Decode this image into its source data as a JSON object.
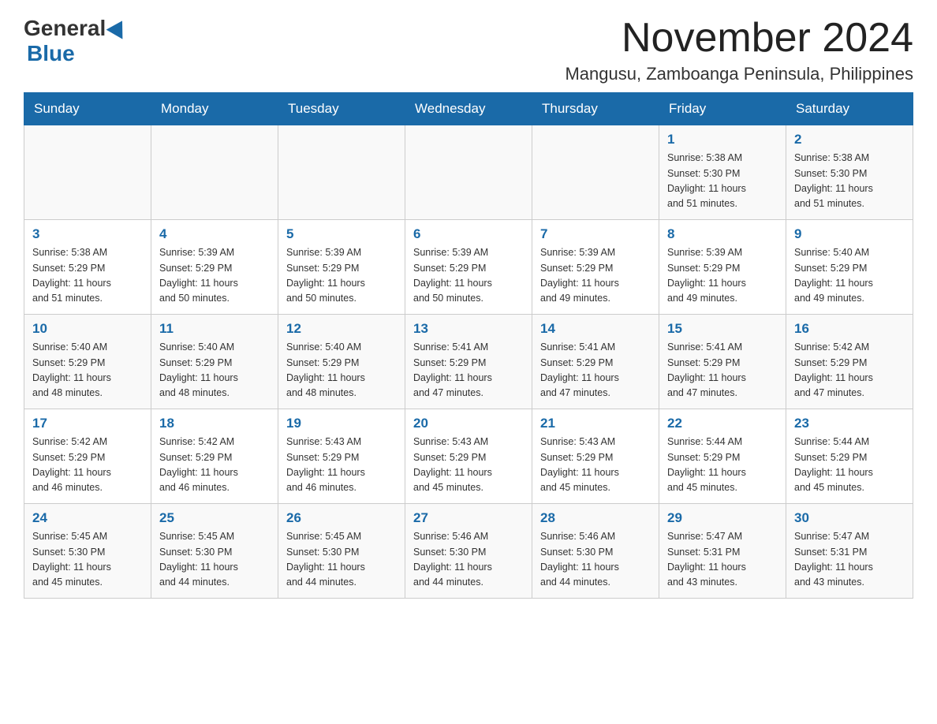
{
  "logo": {
    "general": "General",
    "blue": "Blue"
  },
  "title": "November 2024",
  "location": "Mangusu, Zamboanga Peninsula, Philippines",
  "days_of_week": [
    "Sunday",
    "Monday",
    "Tuesday",
    "Wednesday",
    "Thursday",
    "Friday",
    "Saturday"
  ],
  "weeks": [
    [
      {
        "day": "",
        "info": ""
      },
      {
        "day": "",
        "info": ""
      },
      {
        "day": "",
        "info": ""
      },
      {
        "day": "",
        "info": ""
      },
      {
        "day": "",
        "info": ""
      },
      {
        "day": "1",
        "info": "Sunrise: 5:38 AM\nSunset: 5:30 PM\nDaylight: 11 hours\nand 51 minutes."
      },
      {
        "day": "2",
        "info": "Sunrise: 5:38 AM\nSunset: 5:30 PM\nDaylight: 11 hours\nand 51 minutes."
      }
    ],
    [
      {
        "day": "3",
        "info": "Sunrise: 5:38 AM\nSunset: 5:29 PM\nDaylight: 11 hours\nand 51 minutes."
      },
      {
        "day": "4",
        "info": "Sunrise: 5:39 AM\nSunset: 5:29 PM\nDaylight: 11 hours\nand 50 minutes."
      },
      {
        "day": "5",
        "info": "Sunrise: 5:39 AM\nSunset: 5:29 PM\nDaylight: 11 hours\nand 50 minutes."
      },
      {
        "day": "6",
        "info": "Sunrise: 5:39 AM\nSunset: 5:29 PM\nDaylight: 11 hours\nand 50 minutes."
      },
      {
        "day": "7",
        "info": "Sunrise: 5:39 AM\nSunset: 5:29 PM\nDaylight: 11 hours\nand 49 minutes."
      },
      {
        "day": "8",
        "info": "Sunrise: 5:39 AM\nSunset: 5:29 PM\nDaylight: 11 hours\nand 49 minutes."
      },
      {
        "day": "9",
        "info": "Sunrise: 5:40 AM\nSunset: 5:29 PM\nDaylight: 11 hours\nand 49 minutes."
      }
    ],
    [
      {
        "day": "10",
        "info": "Sunrise: 5:40 AM\nSunset: 5:29 PM\nDaylight: 11 hours\nand 48 minutes."
      },
      {
        "day": "11",
        "info": "Sunrise: 5:40 AM\nSunset: 5:29 PM\nDaylight: 11 hours\nand 48 minutes."
      },
      {
        "day": "12",
        "info": "Sunrise: 5:40 AM\nSunset: 5:29 PM\nDaylight: 11 hours\nand 48 minutes."
      },
      {
        "day": "13",
        "info": "Sunrise: 5:41 AM\nSunset: 5:29 PM\nDaylight: 11 hours\nand 47 minutes."
      },
      {
        "day": "14",
        "info": "Sunrise: 5:41 AM\nSunset: 5:29 PM\nDaylight: 11 hours\nand 47 minutes."
      },
      {
        "day": "15",
        "info": "Sunrise: 5:41 AM\nSunset: 5:29 PM\nDaylight: 11 hours\nand 47 minutes."
      },
      {
        "day": "16",
        "info": "Sunrise: 5:42 AM\nSunset: 5:29 PM\nDaylight: 11 hours\nand 47 minutes."
      }
    ],
    [
      {
        "day": "17",
        "info": "Sunrise: 5:42 AM\nSunset: 5:29 PM\nDaylight: 11 hours\nand 46 minutes."
      },
      {
        "day": "18",
        "info": "Sunrise: 5:42 AM\nSunset: 5:29 PM\nDaylight: 11 hours\nand 46 minutes."
      },
      {
        "day": "19",
        "info": "Sunrise: 5:43 AM\nSunset: 5:29 PM\nDaylight: 11 hours\nand 46 minutes."
      },
      {
        "day": "20",
        "info": "Sunrise: 5:43 AM\nSunset: 5:29 PM\nDaylight: 11 hours\nand 45 minutes."
      },
      {
        "day": "21",
        "info": "Sunrise: 5:43 AM\nSunset: 5:29 PM\nDaylight: 11 hours\nand 45 minutes."
      },
      {
        "day": "22",
        "info": "Sunrise: 5:44 AM\nSunset: 5:29 PM\nDaylight: 11 hours\nand 45 minutes."
      },
      {
        "day": "23",
        "info": "Sunrise: 5:44 AM\nSunset: 5:29 PM\nDaylight: 11 hours\nand 45 minutes."
      }
    ],
    [
      {
        "day": "24",
        "info": "Sunrise: 5:45 AM\nSunset: 5:30 PM\nDaylight: 11 hours\nand 45 minutes."
      },
      {
        "day": "25",
        "info": "Sunrise: 5:45 AM\nSunset: 5:30 PM\nDaylight: 11 hours\nand 44 minutes."
      },
      {
        "day": "26",
        "info": "Sunrise: 5:45 AM\nSunset: 5:30 PM\nDaylight: 11 hours\nand 44 minutes."
      },
      {
        "day": "27",
        "info": "Sunrise: 5:46 AM\nSunset: 5:30 PM\nDaylight: 11 hours\nand 44 minutes."
      },
      {
        "day": "28",
        "info": "Sunrise: 5:46 AM\nSunset: 5:30 PM\nDaylight: 11 hours\nand 44 minutes."
      },
      {
        "day": "29",
        "info": "Sunrise: 5:47 AM\nSunset: 5:31 PM\nDaylight: 11 hours\nand 43 minutes."
      },
      {
        "day": "30",
        "info": "Sunrise: 5:47 AM\nSunset: 5:31 PM\nDaylight: 11 hours\nand 43 minutes."
      }
    ]
  ]
}
